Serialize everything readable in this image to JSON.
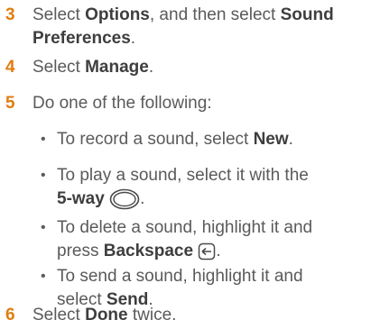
{
  "steps": [
    {
      "num": "3",
      "parts": [
        "Select ",
        "Options",
        ", and then select ",
        "Sound",
        "Preferences",
        "."
      ]
    },
    {
      "num": "4",
      "parts": [
        "Select ",
        "Manage",
        "."
      ]
    },
    {
      "num": "5",
      "text": "Do one of the following:"
    },
    {
      "num": "6",
      "parts": [
        "Select ",
        "Done",
        " twice."
      ]
    }
  ],
  "bullets": [
    {
      "parts": [
        "To record a sound, select ",
        "New",
        "."
      ]
    },
    {
      "parts": [
        "To play a sound, select it with the",
        "5-way",
        "."
      ]
    },
    {
      "parts": [
        "To delete a sound, highlight it and",
        "press ",
        "Backspace",
        "."
      ]
    },
    {
      "parts": [
        "To send a sound, highlight it and",
        "select ",
        "Send",
        "."
      ]
    }
  ],
  "bullet_glyph": "•",
  "icons": {
    "five_way": "5-way-navigator-icon",
    "backspace": "backspace-key-icon"
  }
}
